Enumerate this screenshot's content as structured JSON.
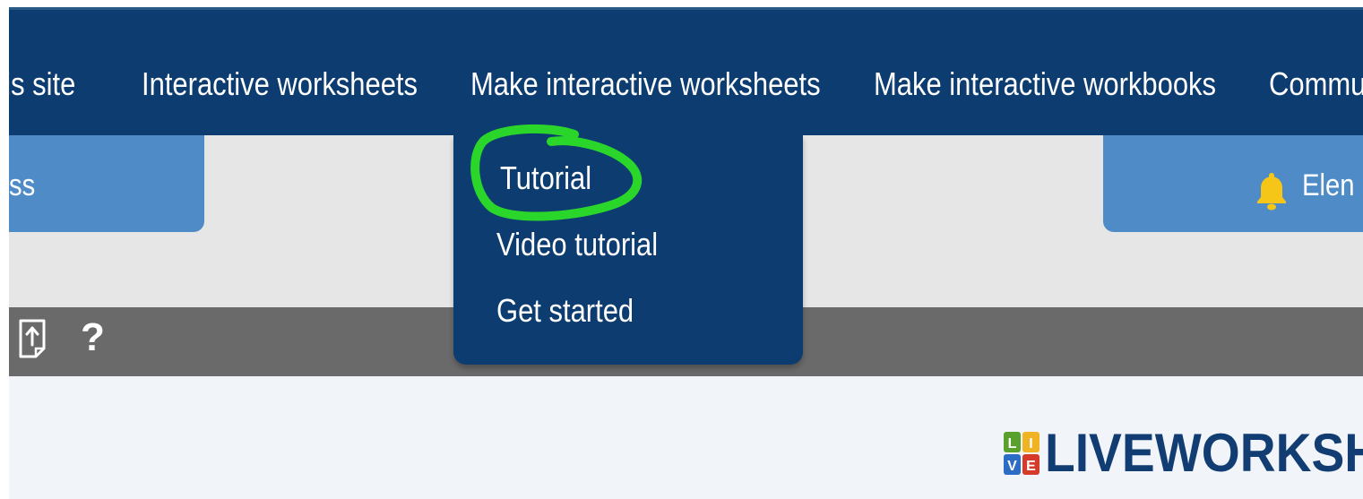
{
  "nav": {
    "items": [
      {
        "label": "his site"
      },
      {
        "label": "Interactive worksheets"
      },
      {
        "label": "Make interactive worksheets"
      },
      {
        "label": "Make interactive workbooks"
      },
      {
        "label": "Commu"
      }
    ]
  },
  "left_tab": {
    "label": "ss"
  },
  "user": {
    "name": "Elen",
    "icon": "bell-icon"
  },
  "toolbar": {
    "upload_icon": "upload-file-icon",
    "help_icon": "?"
  },
  "dropdown": {
    "items": [
      {
        "label": "Tutorial"
      },
      {
        "label": "Video tutorial"
      },
      {
        "label": "Get started"
      }
    ],
    "highlight_color": "#2bd62b"
  },
  "logo": {
    "text": "LIVEWORKSH",
    "mark_letters": [
      "L",
      "I",
      "V",
      "E"
    ]
  },
  "colors": {
    "navbar": "#0d3c70",
    "tab": "#4f8bc6",
    "toolbar": "#6a6a6a",
    "bell": "#f5c518",
    "logo_text": "#123d73"
  }
}
